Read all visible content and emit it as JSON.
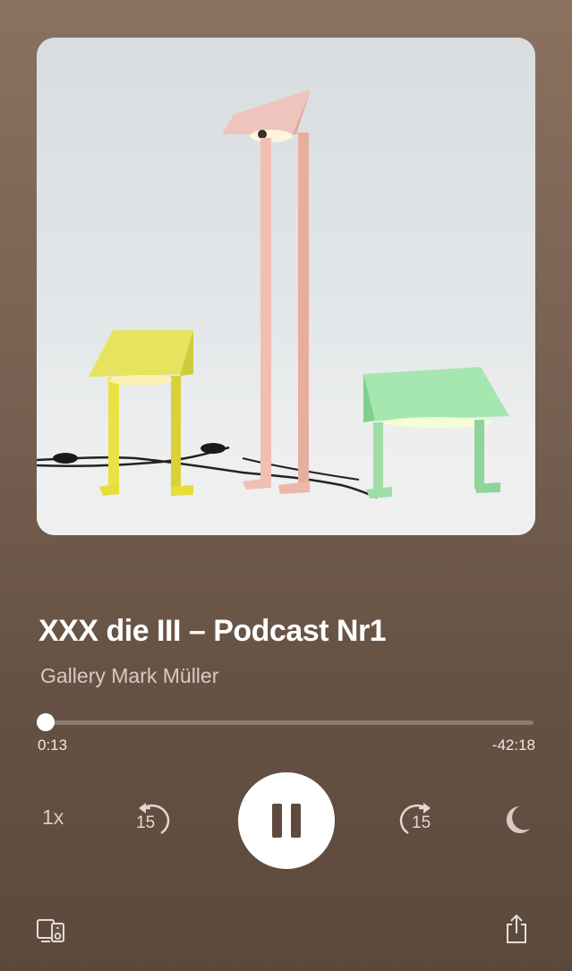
{
  "episode": {
    "title": "XXX die III – Podcast Nr1",
    "show": "Gallery Mark Müller",
    "artwork_icon": "podcast-cover-art"
  },
  "playback": {
    "elapsed": "0:13",
    "remaining": "-42:18",
    "progress_fraction": 0.005,
    "speed_label": "1x",
    "skip_back_label": "15",
    "skip_forward_label": "15",
    "state": "playing"
  },
  "icons": {
    "play_pause": "pause-icon",
    "skip_back": "skip-back-15-icon",
    "skip_forward": "skip-forward-15-icon",
    "sleep_timer": "moon-icon",
    "devices": "connect-devices-icon",
    "share": "share-icon"
  },
  "colors": {
    "background_top": "#8a7160",
    "background_bottom": "#5b493c",
    "accent": "#ffffff",
    "secondary_text": "#d6cbc2"
  }
}
